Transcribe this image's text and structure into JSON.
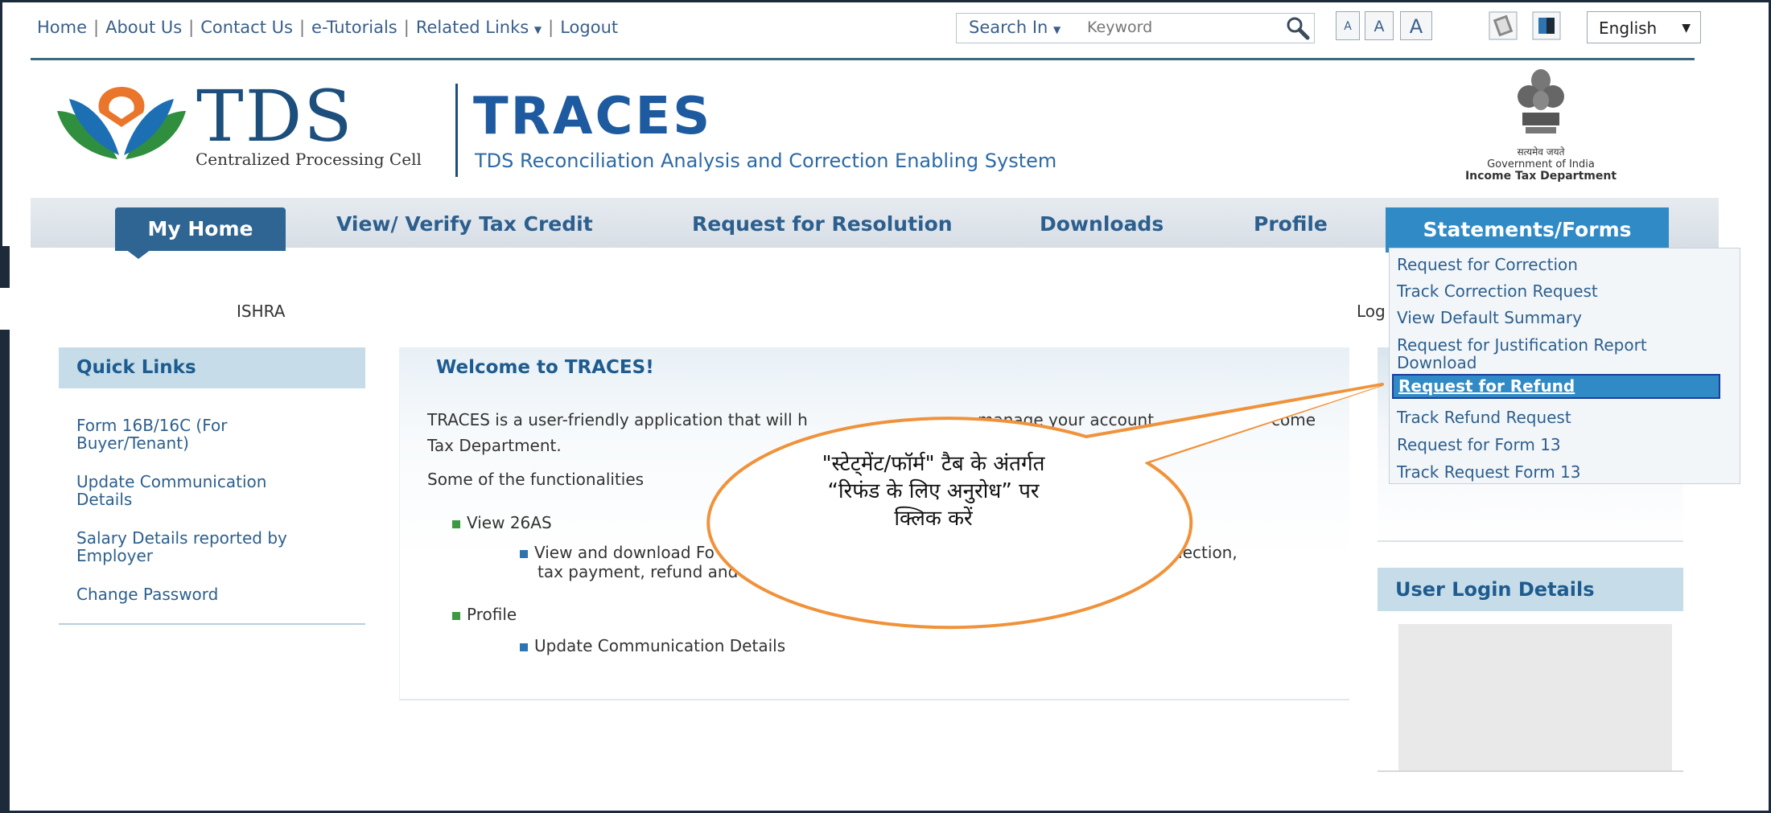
{
  "top_links": [
    "Home",
    "About Us",
    "Contact Us",
    "e-Tutorials",
    "Related Links",
    "Logout"
  ],
  "search": {
    "label": "Search In",
    "placeholder": "Keyword"
  },
  "font_buttons": [
    "A",
    "A",
    "A"
  ],
  "language": "English",
  "header": {
    "logo_text": "TDS",
    "logo_sub": "Centralized Processing Cell",
    "title": "TRACES",
    "subtitle": "TDS Reconciliation Analysis and Correction Enabling System",
    "emblem_line1": "सत्यमेव जयते",
    "emblem_line2": "Government of India",
    "emblem_line3": "Income Tax Department"
  },
  "nav": {
    "my_home": "My Home",
    "items": [
      "View/ Verify Tax Credit",
      "Request for Resolution",
      "Downloads",
      "Profile"
    ],
    "statements": "Statements/Forms"
  },
  "dropdown": {
    "items": [
      "Request for Correction",
      "Track Correction Request",
      "View Default Summary",
      "Request for Justification Report",
      "Download",
      "Request for Refund",
      "Track Refund Request",
      "Request for Form 13",
      "Track Request Form 13"
    ]
  },
  "user_name": "ISHRA",
  "log_text": "Log",
  "quick_links": {
    "title": "Quick Links",
    "items": [
      "Form 16B/16C (For",
      "Buyer/Tenant)",
      "Update Communication",
      "Details",
      "Salary Details reported by",
      "Employer",
      "Change Password"
    ]
  },
  "welcome": {
    "title": "Welcome to TRACES!",
    "line1_a": "TRACES is a user-friendly application that will h",
    "line1_b": "manage your account",
    "line1_c": "come",
    "line2": "Tax Department.",
    "line3": "Some of the functionalities",
    "view26as": "View 26AS",
    "sub1_a": "View and download Fo",
    "sub1_b": "duction, collection,",
    "sub2": "tax payment, refund and AIR",
    "profile": "Profile",
    "sub3": "Update Communication Details"
  },
  "user_login": {
    "title": "User Login Details"
  },
  "callout": {
    "line1": "\"स्टेट्मेंट/फॉर्म\" टैब के अंतर्गत",
    "line2": "“रिफंड के लिए अनुरोध” पर",
    "line3": "क्लिक करें"
  },
  "colors": {
    "nav_blue": "#2e6592",
    "tab_blue": "#2f8ac6",
    "callout_border": "#f0923a"
  }
}
